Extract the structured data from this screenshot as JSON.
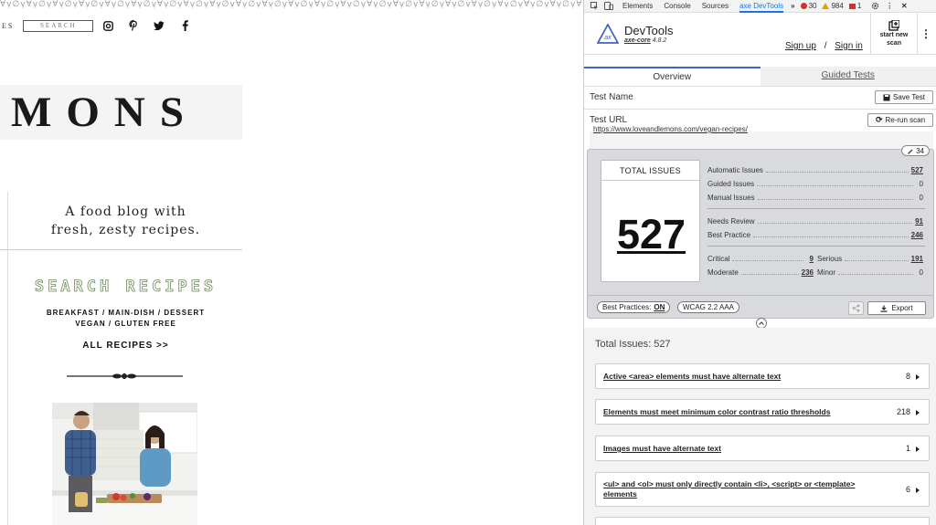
{
  "site": {
    "deco_pattern": "∀ṿ∅ṿ∀ṿ∅ṿ∀ṿ∅ṿ∀ṿ∅ṿ∀ṿ∅ṿ∀ṿ∅ṿ∀ṿ∅ṿ∀ṿ∅ṿ∀ṿ∅ṿ∀ṿ∅ṿ∀ṿ∅ṿ∀ṿ∅ṿ∀ṿ∅ṿ∀ṿ∅ṿ∀ṿ∅ṿ∀ṿ∅ṿ∀ṿ∅ṿ∀ṿ∅ṿ∀ṿ∅ṿ∀ṿ∅ṿ∀ṿ∅ṿ∀ṿ∅ṿ∀ṿ∅ṿ∀ṿ∅ṿ∀ṿ∅ṿ∀ṿ∅ṿ",
    "nav_fragment": "ES",
    "search_placeholder": "SEARCH",
    "logo_text": "MONS",
    "tagline_line1": "A food blog with",
    "tagline_line2": "fresh, zesty recipes.",
    "search_recipes": "SEARCH RECIPES",
    "categories_line1": "BREAKFAST  /  MAIN-DISH  /  DESSERT",
    "categories_line2": "VEGAN  /  GLUTEN FREE",
    "all_recipes": "ALL RECIPES >>",
    "social_icons": [
      "instagram-icon",
      "pinterest-icon",
      "twitter-icon",
      "facebook-icon"
    ]
  },
  "devtools_tabs": {
    "items": [
      "Elements",
      "Console",
      "Sources",
      "axe DevTools"
    ],
    "active": "axe DevTools",
    "more": "»",
    "errors": "30",
    "warnings": "984",
    "issues": "1"
  },
  "axe": {
    "title": "DevTools",
    "core_label": "axe-core",
    "core_version": "4.8.2",
    "sign_up": "Sign up",
    "slash": "/",
    "sign_in": "Sign in",
    "new_scan_line1": "start new",
    "new_scan_line2": "scan",
    "tab_overview": "Overview",
    "tab_guided": "Guided Tests",
    "test_name_label": "Test Name",
    "save_test": "Save Test",
    "test_url_label": "Test URL",
    "rerun_scan": "Re-run scan",
    "url": "https://www.loveandlemons.com/vegan-recipes/",
    "highlight_count": "34",
    "total_issues_label": "TOTAL ISSUES",
    "total_issues": "527",
    "stats": {
      "automatic_label": "Automatic Issues",
      "automatic": "527",
      "guided_label": "Guided Issues",
      "guided": "0",
      "manual_label": "Manual Issues",
      "manual": "0",
      "needs_review_label": "Needs Review",
      "needs_review": "91",
      "best_practice_label": "Best Practice",
      "best_practice": "246",
      "critical_label": "Critical",
      "critical": "9",
      "serious_label": "Serious",
      "serious": "191",
      "moderate_label": "Moderate",
      "moderate": "236",
      "minor_label": "Minor",
      "minor": "0"
    },
    "best_practices_label": "Best Practices:",
    "best_practices_value": "ON",
    "wcag_label": "WCAG 2.2 AAA",
    "export": "Export",
    "total_issues_heading": "Total Issues: 527",
    "issues": [
      {
        "title": "Active <area> elements must have alternate text",
        "count": "8"
      },
      {
        "title": "Elements must meet minimum color contrast ratio thresholds",
        "count": "218"
      },
      {
        "title": "Images must have alternate text",
        "count": "1"
      },
      {
        "title": "<ul> and <ol> must only directly contain <li>, <script> or <template> elements",
        "count": "6"
      }
    ]
  },
  "colors": {
    "accent_blue": "#3f64c4",
    "error_red": "#d93025",
    "warning_orange": "#f29900",
    "search_recipes_green": "#6a8a5a"
  }
}
